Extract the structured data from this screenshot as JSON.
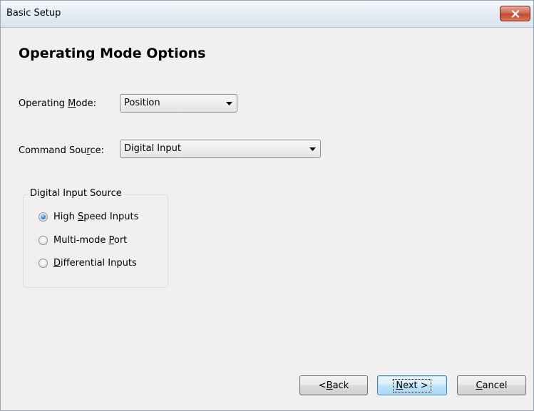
{
  "window": {
    "title": "Basic Setup"
  },
  "page": {
    "title": "Operating Mode Options"
  },
  "operating_mode": {
    "label_pre": "Operating ",
    "label_mnemonic": "M",
    "label_post": "ode:",
    "value": "Position"
  },
  "command_source": {
    "label_pre": "Command Sou",
    "label_mnemonic": "r",
    "label_post": "ce:",
    "value": "Digital Input"
  },
  "digital_input_source": {
    "legend": "Digital Input Source",
    "options": [
      {
        "pre": "High ",
        "mnemonic": "S",
        "post": "peed Inputs",
        "selected": true
      },
      {
        "pre": "Multi-mode ",
        "mnemonic": "P",
        "post": "ort",
        "selected": false
      },
      {
        "pre": "",
        "mnemonic": "D",
        "post": "ifferential Inputs",
        "selected": false
      }
    ]
  },
  "buttons": {
    "back": {
      "pre": "< ",
      "mnemonic": "B",
      "post": "ack"
    },
    "next": {
      "pre": "",
      "mnemonic": "N",
      "post": "ext >"
    },
    "cancel": {
      "pre": "",
      "mnemonic": "C",
      "post": "ancel"
    }
  },
  "icons": {
    "close": "close-icon",
    "dropdown": "chevron-down-icon"
  },
  "colors": {
    "close_button": "#c34a31",
    "radio_selected": "#2f7fd3",
    "default_button_border": "#3c7fb1"
  }
}
